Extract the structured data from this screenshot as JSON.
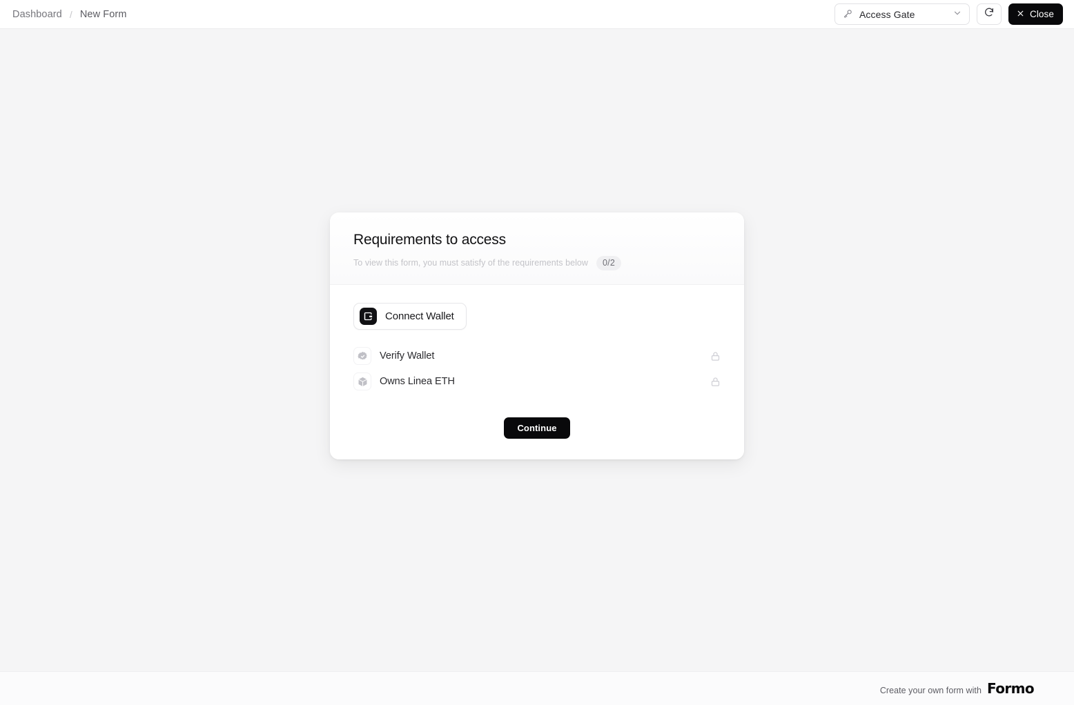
{
  "topbar": {
    "breadcrumb": {
      "root": "Dashboard",
      "separator": "/",
      "current": "New Form"
    },
    "gate_select": {
      "icon": "key-icon",
      "value": "Access Gate",
      "chevron": "chevron-down-icon"
    },
    "refresh": {
      "icon": "refresh-icon",
      "label": ""
    },
    "close": {
      "icon": "close-x-icon",
      "label": "Close"
    }
  },
  "gate_card": {
    "title": "Requirements to access",
    "subtitle": "To view this form, you must satisfy of the requirements below",
    "count_badge": "0/2",
    "connect_wallet": {
      "label": "Connect Wallet",
      "icon": "wallet-icon"
    },
    "requirements": [
      {
        "label": "Verify Wallet",
        "icon": "badge-check-icon",
        "status_icon": "lock-icon",
        "locked": true
      },
      {
        "label": "Owns Linea ETH",
        "icon": "cube-icon",
        "status_icon": "lock-icon",
        "locked": true
      }
    ],
    "continue_label": "Continue"
  },
  "footer": {
    "text": "Create your own form with",
    "brand": "Formo"
  },
  "colors": {
    "page_bg": "#f5f5f6",
    "card_bg": "#ffffff",
    "accent_dark": "#09090b",
    "muted_text": "#c3c3c8",
    "badge_bg": "#f0f0f2"
  }
}
